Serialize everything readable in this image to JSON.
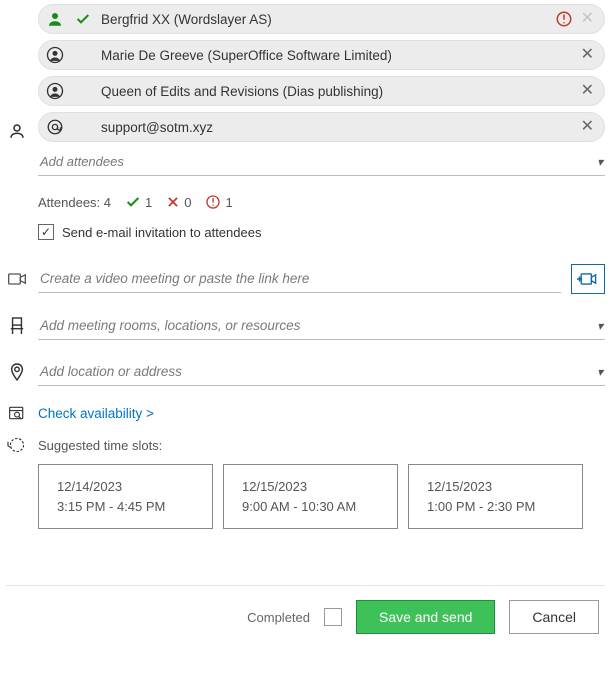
{
  "attendees": {
    "organizer": {
      "name": "Bergfrid XX (Wordslayer AS)"
    },
    "list": [
      {
        "name": "Marie De Greeve (SuperOffice Software Limited)"
      },
      {
        "name": "Queen of Edits and Revisions (Dias publishing)"
      },
      {
        "name": "support@sotm.xyz"
      }
    ],
    "add_placeholder": "Add attendees",
    "stats_label": "Attendees: 4",
    "accepted_count": "1",
    "declined_count": "0",
    "pending_count": "1",
    "send_email_label": "Send e-mail invitation to attendees"
  },
  "video": {
    "placeholder": "Create a video meeting or paste the link here"
  },
  "rooms": {
    "placeholder": "Add meeting rooms, locations, or resources"
  },
  "location": {
    "placeholder": "Add location or address"
  },
  "availability": {
    "link_label": "Check availability >"
  },
  "suggested": {
    "label": "Suggested time slots:",
    "slots": [
      {
        "date": "12/14/2023",
        "time": "3:15 PM - 4:45 PM"
      },
      {
        "date": "12/15/2023",
        "time": "9:00 AM - 10:30 AM"
      },
      {
        "date": "12/15/2023",
        "time": "1:00 PM - 2:30 PM"
      }
    ]
  },
  "footer": {
    "completed_label": "Completed",
    "save_label": "Save and send",
    "cancel_label": "Cancel"
  }
}
